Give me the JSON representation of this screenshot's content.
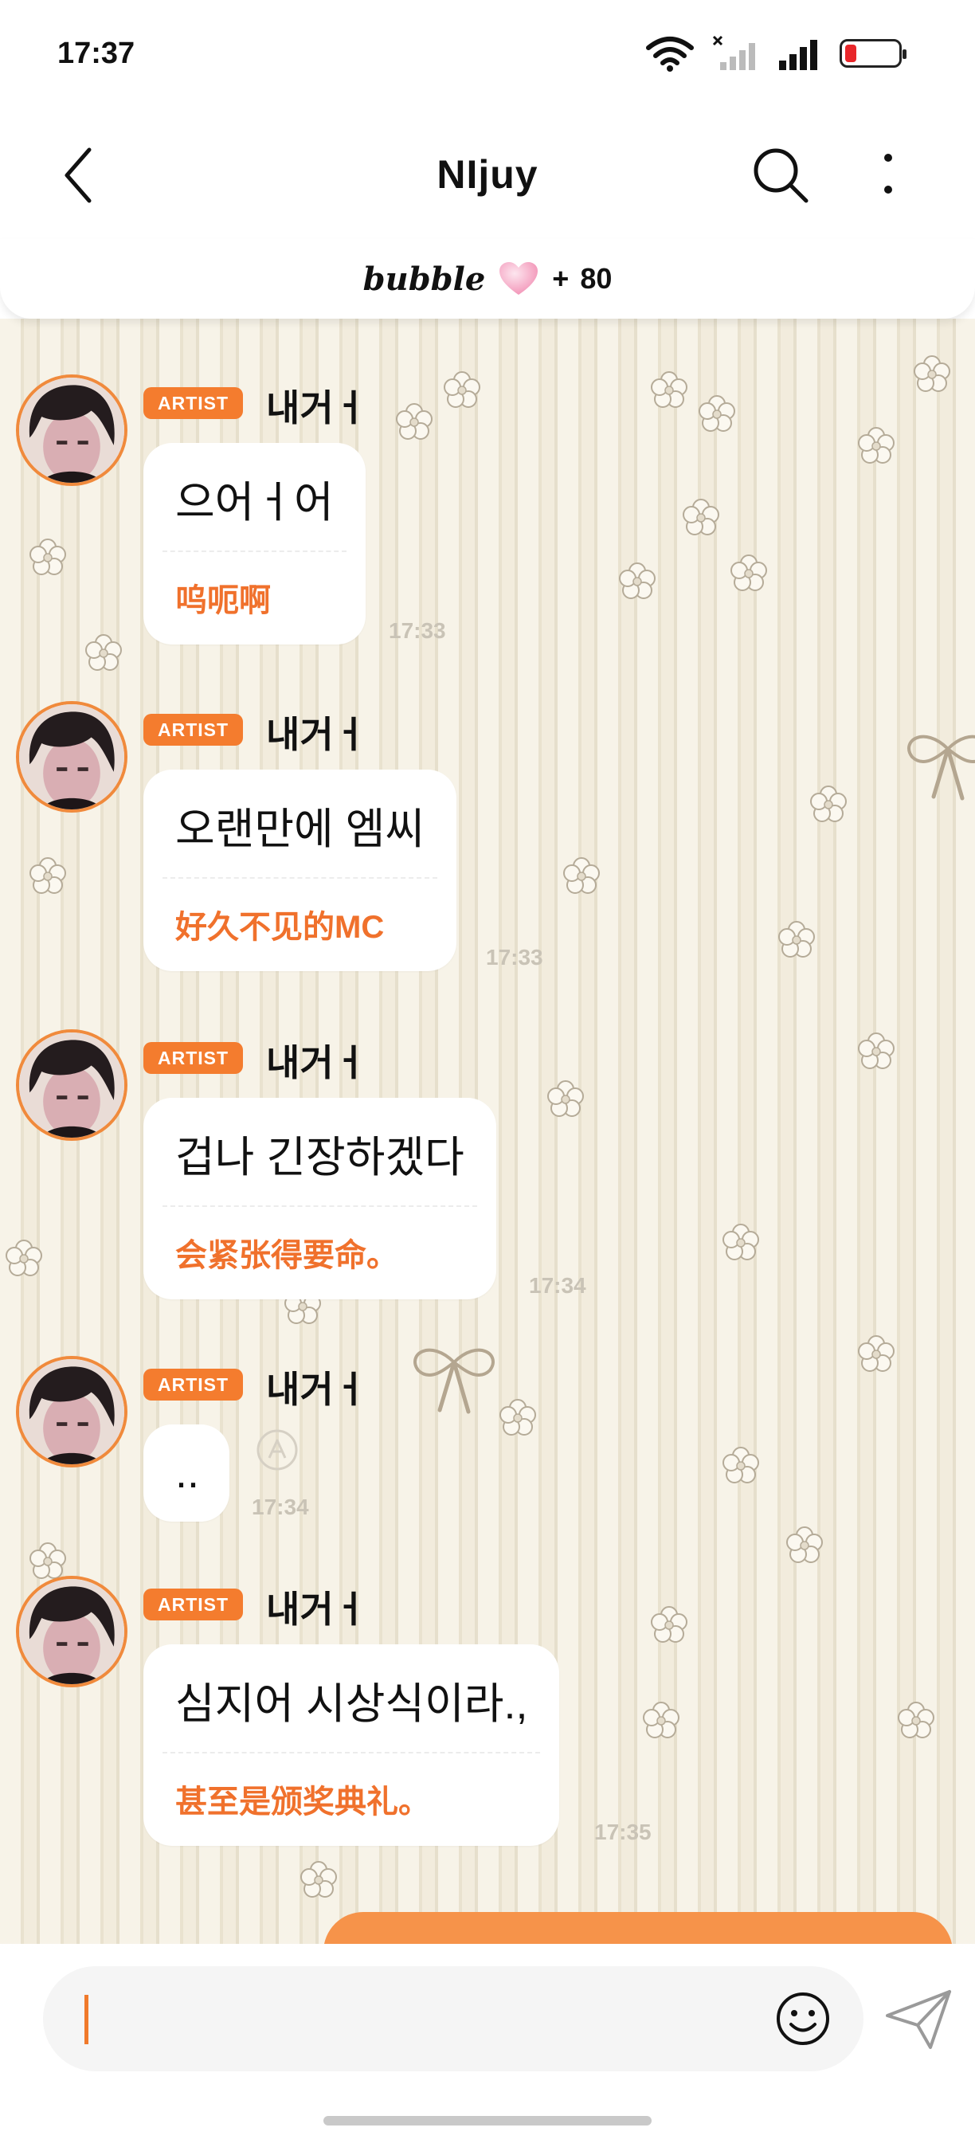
{
  "status_bar": {
    "time": "17:37",
    "icons": [
      "wifi-icon",
      "signal-off-icon",
      "signal-icon",
      "battery-low-icon"
    ],
    "battery_color": "#e8262a"
  },
  "header": {
    "title": "NIjuy",
    "back_icon": "chevron-left-icon",
    "search_icon": "search-icon",
    "more_icon": "more-vertical-icon"
  },
  "bubble_bar": {
    "logo": "bubble",
    "heart_icon": "heart-icon",
    "plus": "+",
    "count": "80"
  },
  "messages": [
    {
      "badge": "ARTIST",
      "sender": "내거ㅓ",
      "text": "으어ㅓ어",
      "translation": "呜呃啊",
      "time": "17:33"
    },
    {
      "badge": "ARTIST",
      "sender": "내거ㅓ",
      "text": "오랜만에 엠씨",
      "translation": "好久不见的MC",
      "time": "17:33"
    },
    {
      "badge": "ARTIST",
      "sender": "내거ㅓ",
      "text": "겁나 긴장하겠다",
      "translation": "会紧张得要命。",
      "time": "17:34"
    },
    {
      "badge": "ARTIST",
      "sender": "내거ㅓ",
      "text": "..",
      "translation": "",
      "time": "17:34"
    },
    {
      "badge": "ARTIST",
      "sender": "내거ㅓ",
      "text": "심지어 시상식이라.,",
      "translation": "甚至是颁奖典礼。",
      "time": "17:35"
    }
  ],
  "input": {
    "value": "",
    "emoji_icon": "smiley-icon",
    "send_icon": "send-icon"
  },
  "colors": {
    "accent": "#f47c2e",
    "translation": "#f0712c",
    "outgoing": "#f6934a"
  }
}
